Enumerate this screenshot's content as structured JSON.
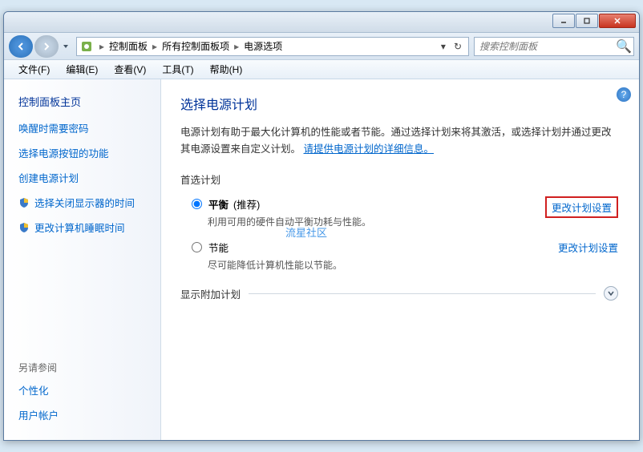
{
  "titlebar": {
    "min": "_",
    "max": "□",
    "close": "×"
  },
  "nav": {
    "crumbs": [
      "控制面板",
      "所有控制面板项",
      "电源选项"
    ],
    "search_placeholder": "搜索控制面板"
  },
  "menu": {
    "file": "文件(F)",
    "edit": "编辑(E)",
    "view": "查看(V)",
    "tools": "工具(T)",
    "help": "帮助(H)"
  },
  "sidebar": {
    "home": "控制面板主页",
    "items": [
      "唤醒时需要密码",
      "选择电源按钮的功能",
      "创建电源计划",
      "选择关闭显示器的时间",
      "更改计算机睡眠时间"
    ],
    "see_also": "另请参阅",
    "personalize": "个性化",
    "accounts": "用户帐户"
  },
  "main": {
    "heading": "选择电源计划",
    "desc_1": "电源计划有助于最大化计算机的性能或者节能。通过选择计划来将其激活，或选择计划并通过更改其电源设置来自定义计划。",
    "desc_link": "请提供电源计划的详细信息。",
    "preferred_label": "首选计划",
    "plans": [
      {
        "name": "平衡",
        "rec": "(推荐)",
        "desc": "利用可用的硬件自动平衡功耗与性能。",
        "change": "更改计划设置",
        "checked": true,
        "highlight": true
      },
      {
        "name": "节能",
        "rec": "",
        "desc": "尽可能降低计算机性能以节能。",
        "change": "更改计划设置",
        "checked": false,
        "highlight": false
      }
    ],
    "addl": "显示附加计划"
  },
  "watermark": "流星社区"
}
